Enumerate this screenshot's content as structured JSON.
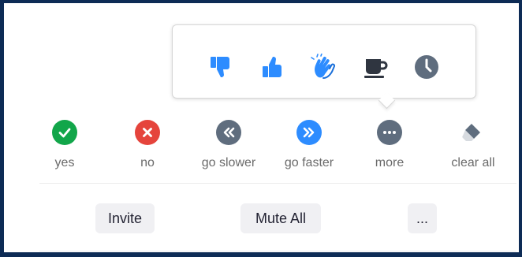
{
  "colors": {
    "frame": "#0d2b55",
    "accent_blue": "#2d8cff",
    "green": "#12a64a",
    "red": "#e5443c",
    "gray": "#5f6d7e",
    "button_bg": "#f0f0f3"
  },
  "popover": {
    "icons": [
      {
        "name": "thumbs-down-icon"
      },
      {
        "name": "thumbs-up-icon"
      },
      {
        "name": "clapping-hands-icon"
      },
      {
        "name": "coffee-cup-icon"
      },
      {
        "name": "clock-icon"
      }
    ]
  },
  "reactions": [
    {
      "name": "yes",
      "label": "yes",
      "icon": "checkmark-icon"
    },
    {
      "name": "no",
      "label": "no",
      "icon": "x-icon"
    },
    {
      "name": "go-slower",
      "label": "go slower",
      "icon": "rewind-icon"
    },
    {
      "name": "go-faster",
      "label": "go faster",
      "icon": "fast-forward-icon"
    },
    {
      "name": "more",
      "label": "more",
      "icon": "ellipsis-icon"
    },
    {
      "name": "clear-all",
      "label": "clear all",
      "icon": "eraser-icon"
    }
  ],
  "buttons": {
    "invite": "Invite",
    "mute_all": "Mute All",
    "more": "..."
  }
}
